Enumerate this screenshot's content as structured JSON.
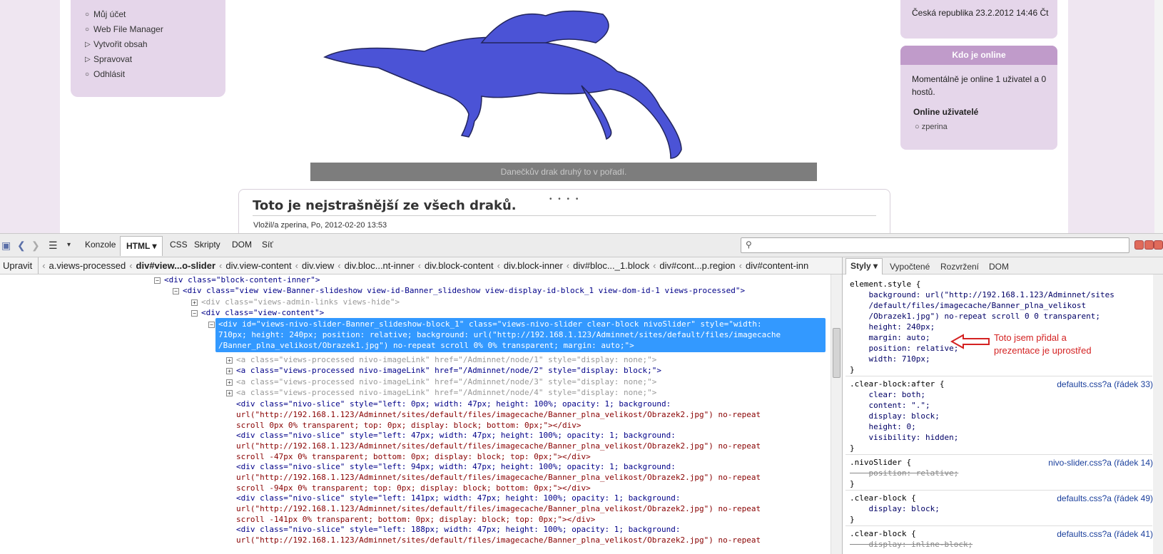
{
  "page": {
    "menu": [
      "Můj účet",
      "Web File Manager",
      "Vytvořit obsah",
      "Spravovat",
      "Odhlásit"
    ],
    "menu_bullets": [
      "○",
      "○",
      "▷",
      "▷",
      "○"
    ],
    "slider_caption": "Danečkův drak druhý to v pořadí.",
    "slider_dots": "• • • •",
    "article_title": "Toto je nejstrašnější ze všech draků.",
    "article_meta": "Vložil/a zperina, Po, 2012-02-20 13:53",
    "date_text": "Česká republika 23.2.2012 14:46 Čt",
    "online_header": "Kdo je online",
    "online_text": "Momentálně je online 1 uživatel a 0 hostů.",
    "online_users_header": "Online uživatelé",
    "online_user": "zperina"
  },
  "toolbar": {
    "tabs": [
      "Konzole",
      "HTML ▾",
      "CSS",
      "Skripty",
      "DOM",
      "Síť"
    ],
    "search_value": ""
  },
  "breadcrumb": {
    "edit": "Upravit",
    "items": [
      "a.views-processed",
      "div#view...o-slider",
      "div.view-content",
      "div.view",
      "div.bloc...nt-inner",
      "div.block-content",
      "div.block-inner",
      "div#bloc..._1.block",
      "div#cont...p.region",
      "div#content-inn"
    ]
  },
  "html_lines": [
    "<div class=\"block-content-inner\">",
    "<div class=\"view view-Banner-slideshow view-id-Banner_slideshow view-display-id-block_1 view-dom-id-1 views-processed\">",
    "<div class=\"views-admin-links views-hide\">",
    "<div class=\"view-content\">",
    "<div id=\"views-nivo-slider-Banner_slideshow-block_1\" class=\"views-nivo-slider clear-block nivoSlider\" style=\"width:",
    "710px; height: 240px; position: relative; background: url(\"http://192.168.1.123/Adminnet/sites/default/files/imagecache",
    "/Banner_plna_velikost/Obrazek1.jpg\") no-repeat scroll 0% 0% transparent; margin: auto;\">",
    "<a class=\"views-processed nivo-imageLink\" href=\"/Adminnet/node/1\" style=\"display: none;\">",
    "<a class=\"views-processed nivo-imageLink\" href=\"/Adminnet/node/2\" style=\"display: block;\">",
    "<a class=\"views-processed nivo-imageLink\" href=\"/Adminnet/node/3\" style=\"display: none;\">",
    "<a class=\"views-processed nivo-imageLink\" href=\"/Adminnet/node/4\" style=\"display: none;\">",
    "<div class=\"nivo-slice\" style=\"left: 0px; width: 47px; height: 100%; opacity: 1; background:",
    "url(\"http://192.168.1.123/Adminnet/sites/default/files/imagecache/Banner_plna_velikost/Obrazek2.jpg\") no-repeat",
    "scroll 0px 0% transparent; top: 0px; display: block; bottom: 0px;\"></div>",
    "<div class=\"nivo-slice\" style=\"left: 47px; width: 47px; height: 100%; opacity: 1; background:",
    "url(\"http://192.168.1.123/Adminnet/sites/default/files/imagecache/Banner_plna_velikost/Obrazek2.jpg\") no-repeat",
    "scroll -47px 0% transparent; bottom: 0px; display: block; top: 0px;\"></div>",
    "<div class=\"nivo-slice\" style=\"left: 94px; width: 47px; height: 100%; opacity: 1; background:",
    "url(\"http://192.168.1.123/Adminnet/sites/default/files/imagecache/Banner_plna_velikost/Obrazek2.jpg\") no-repeat",
    "scroll -94px 0% transparent; top: 0px; display: block; bottom: 0px;\"></div>",
    "<div class=\"nivo-slice\" style=\"left: 141px; width: 47px; height: 100%; opacity: 1; background:",
    "url(\"http://192.168.1.123/Adminnet/sites/default/files/imagecache/Banner_plna_velikost/Obrazek2.jpg\") no-repeat",
    "scroll -141px 0% transparent; bottom: 0px; display: block; top: 0px;\"></div>",
    "<div class=\"nivo-slice\" style=\"left: 188px; width: 47px; height: 100%; opacity: 1; background:",
    "url(\"http://192.168.1.123/Adminnet/sites/default/files/imagecache/Banner_plna_velikost/Obrazek2.jpg\") no-repeat"
  ],
  "style_panel": {
    "tabs": [
      "Styly ▾",
      "Vypočtené",
      "Rozvržení",
      "DOM"
    ],
    "element_style": "element.style {",
    "es_lines": [
      "    background: url(\"http://192.168.1.123/Adminnet/sites",
      "    /default/files/imagecache/Banner_plna_velikost",
      "    /Obrazek1.jpg\") no-repeat scroll 0 0 transparent;",
      "    height: 240px;",
      "    margin: auto;",
      "    position: relative;",
      "    width: 710px;",
      "}"
    ],
    "rule2_sel": ".clear-block:after {",
    "rule2_src": "defaults.css?a (řádek 33)",
    "rule2_lines": [
      "    clear: both;",
      "    content: \".\";",
      "    display: block;",
      "    height: 0;",
      "    visibility: hidden;",
      "}"
    ],
    "rule3_sel": ".nivoSlider {",
    "rule3_src": "nivo-slider.css?a (řádek 14)",
    "rule3_line": "    position: relative;",
    "rule3_end": "}",
    "rule4_sel": ".clear-block {",
    "rule4_src": "defaults.css?a (řádek 49)",
    "rule4_line": "    display: block;",
    "rule4_end": "}",
    "rule5_sel": ".clear-block {",
    "rule5_src": "defaults.css?a (řádek 41)",
    "rule5_line": "    display: inline-block;"
  },
  "annotation": "Toto jsem přidal a prezentace je uprostřed",
  "colors": {
    "annotation": "#d42222",
    "selection": "#3399ff",
    "sidebar_box": "#e5d6ea",
    "online_header": "#c09bca"
  }
}
